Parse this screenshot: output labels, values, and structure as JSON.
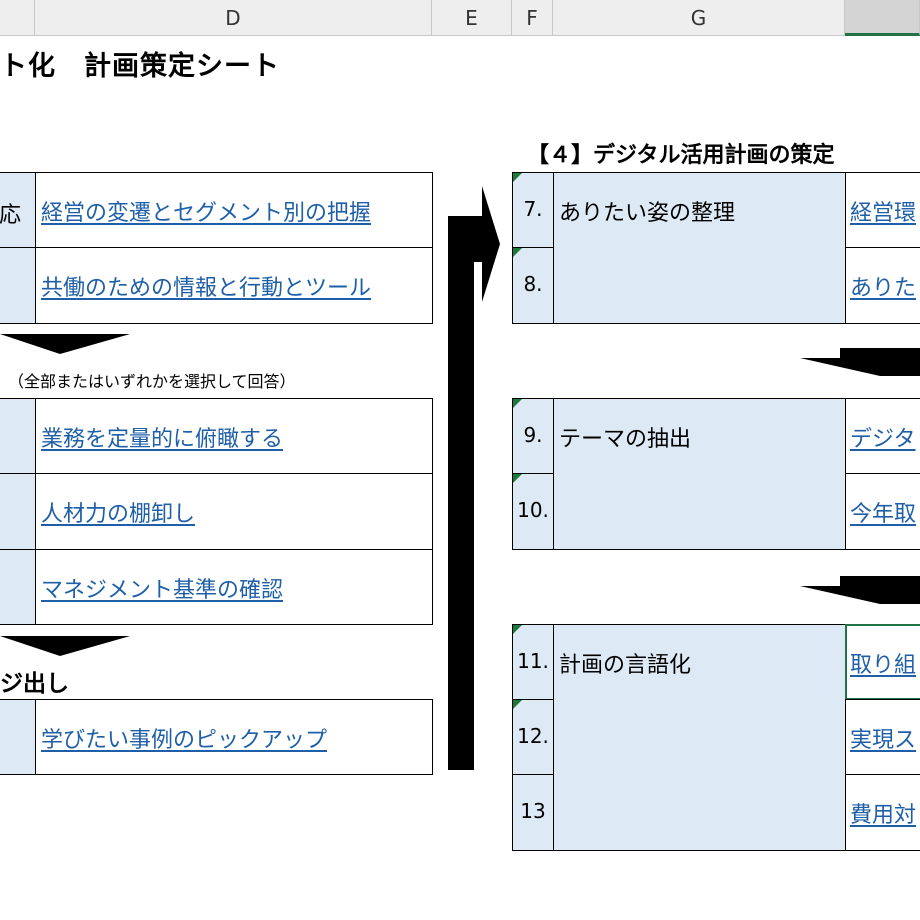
{
  "columns": {
    "d": "D",
    "e": "E",
    "f": "F",
    "g": "G"
  },
  "title": "ト化　計画策定シート",
  "left": {
    "row1_label": "応",
    "links1": [
      "経営の変遷とセグメント別の把握",
      "共働のための情報と行動とツール"
    ],
    "note": "（全部またはいずれかを選択して回答）",
    "links2": [
      "業務を定量的に俯瞰する",
      "人材力の棚卸し",
      "マネジメント基準の確認"
    ],
    "section3": "ジ出し",
    "links3": [
      "学びたい事例のピックアップ"
    ]
  },
  "right": {
    "section_title": "【４】デジタル活用計画の策定",
    "group1": {
      "title": "ありたい姿の整理",
      "nums": [
        "7.",
        "8."
      ],
      "links": [
        "経営環",
        "ありた"
      ]
    },
    "group2": {
      "title": "テーマの抽出",
      "nums": [
        "9.",
        "10."
      ],
      "links": [
        "デジタ",
        "今年取"
      ]
    },
    "group3": {
      "title": "計画の言語化",
      "nums": [
        "11.",
        "12.",
        "13"
      ],
      "links": [
        "取り組",
        "実現ス",
        "費用対"
      ]
    }
  },
  "colors": {
    "link": "#1f5fa8",
    "cell_fill": "#dde9f5",
    "selected_border": "#217346",
    "comment_marker": "#1e7a3c"
  }
}
